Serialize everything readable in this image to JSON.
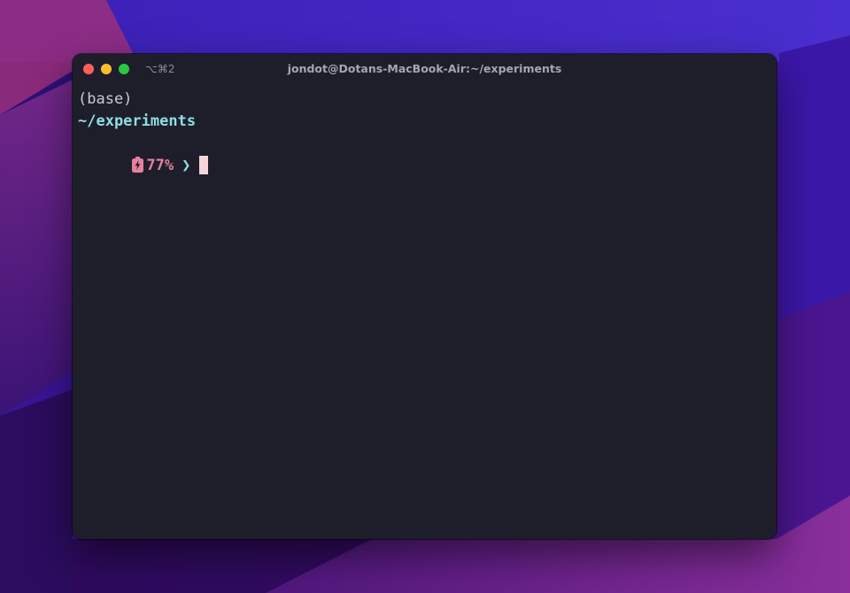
{
  "window": {
    "title": "jondot@Dotans-MacBook-Air:~/experiments",
    "shortcut": "⌥⌘2",
    "traffic_lights": {
      "close": "#fe5f57",
      "minimize": "#febc2e",
      "zoom": "#28c840"
    }
  },
  "terminal": {
    "background": "#1e1e2b",
    "env_line": "(base)",
    "cwd_line": "~/experiments",
    "prompt": {
      "battery_icon": "battery-charging-icon",
      "battery_percent": "77%",
      "arrow": "❯"
    }
  },
  "colors": {
    "env": "#c8cad4",
    "cwd": "#8fdde4",
    "battery": "#e4819e",
    "cursor": "#f4d6d8",
    "wallpaper_purple": "#3a1590",
    "wallpaper_magenta": "#8a2f9c"
  }
}
